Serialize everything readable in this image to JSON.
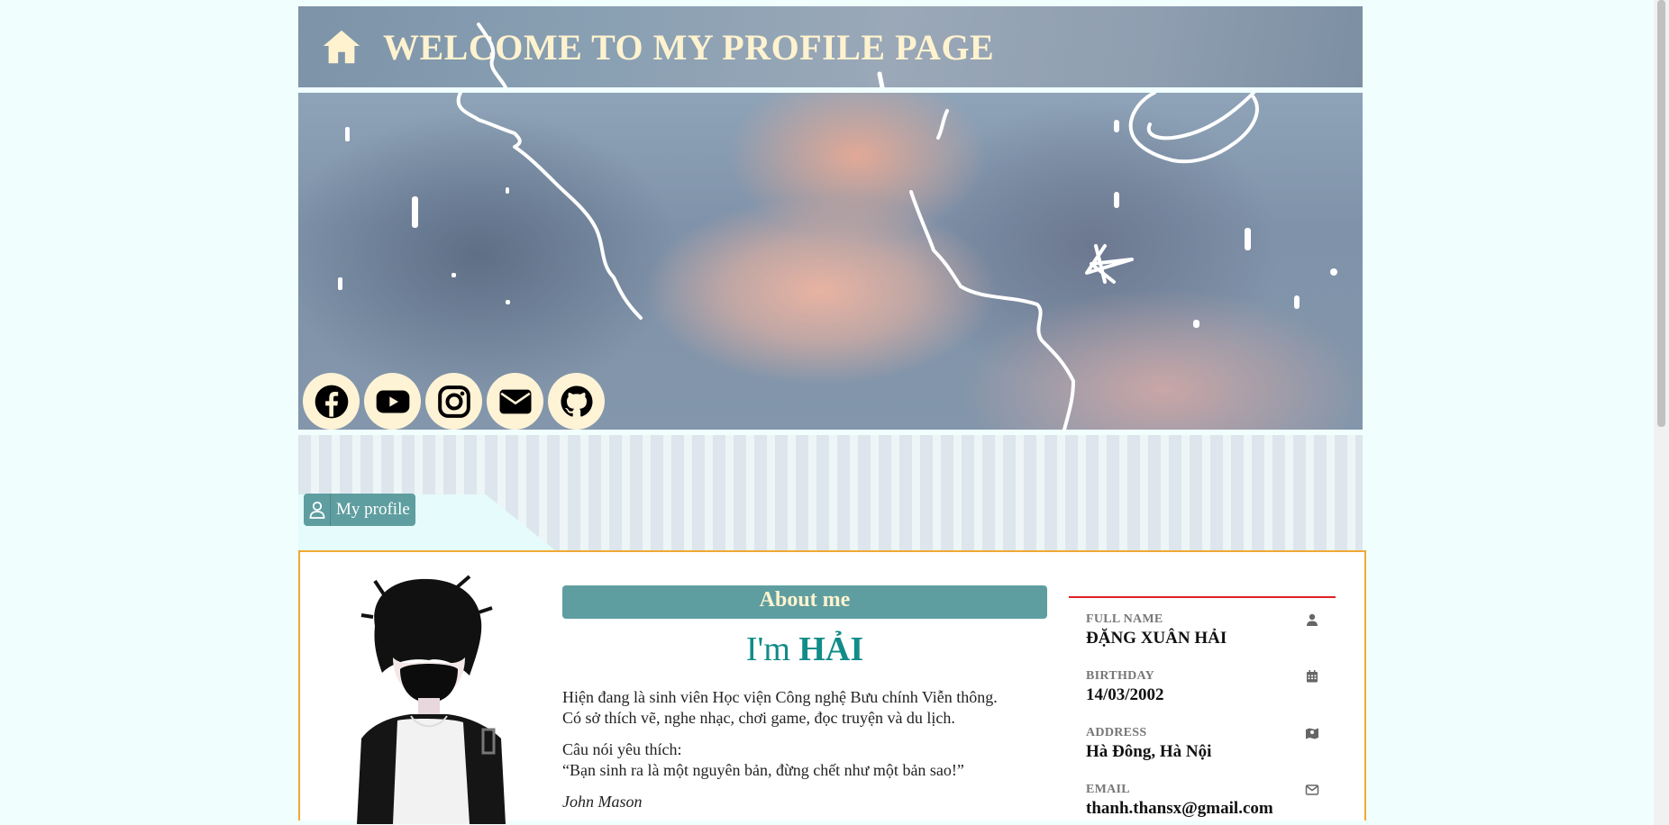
{
  "header": {
    "title": "WELCOME TO MY PROFILE PAGE",
    "home_icon": "home-icon"
  },
  "socials": [
    {
      "name": "facebook",
      "icon": "facebook-icon"
    },
    {
      "name": "youtube",
      "icon": "youtube-icon"
    },
    {
      "name": "instagram",
      "icon": "instagram-icon"
    },
    {
      "name": "email",
      "icon": "envelope-icon"
    },
    {
      "name": "github",
      "icon": "github-icon"
    }
  ],
  "tab": {
    "label": "My profile",
    "icon": "user-icon"
  },
  "about": {
    "heading": "About me",
    "im_prefix": "I'm",
    "name": "HẢI",
    "paragraph1_line1": "Hiện đang là sinh viên Học viện Công nghệ Bưu chính Viễn thông.",
    "paragraph1_line2": "Có sở thích vẽ, nghe nhạc, chơi game, đọc truyện và du lịch.",
    "quote_label": "Câu nói yêu thích:",
    "quote": "“Bạn sinh ra là một nguyên bản, đừng chết như một bản sao!”",
    "quote_author": "John Mason"
  },
  "info": {
    "items": [
      {
        "label": "FULL NAME",
        "value": "ĐẶNG XUÂN HẢI",
        "icon": "user-icon"
      },
      {
        "label": "BIRTHDAY",
        "value": "14/03/2002",
        "icon": "calendar-icon"
      },
      {
        "label": "ADDRESS",
        "value": "Hà Đông, Hà Nội",
        "icon": "map-icon"
      },
      {
        "label": "EMAIL",
        "value": "thanh.thansx@gmail.com",
        "icon": "envelope-icon"
      }
    ]
  },
  "colors": {
    "page_bg": "#f0fffe",
    "accent_teal": "#5f9ea0",
    "title_cream": "#fff3cf",
    "card_border": "#f0a934",
    "info_divider": "#dd2222"
  }
}
